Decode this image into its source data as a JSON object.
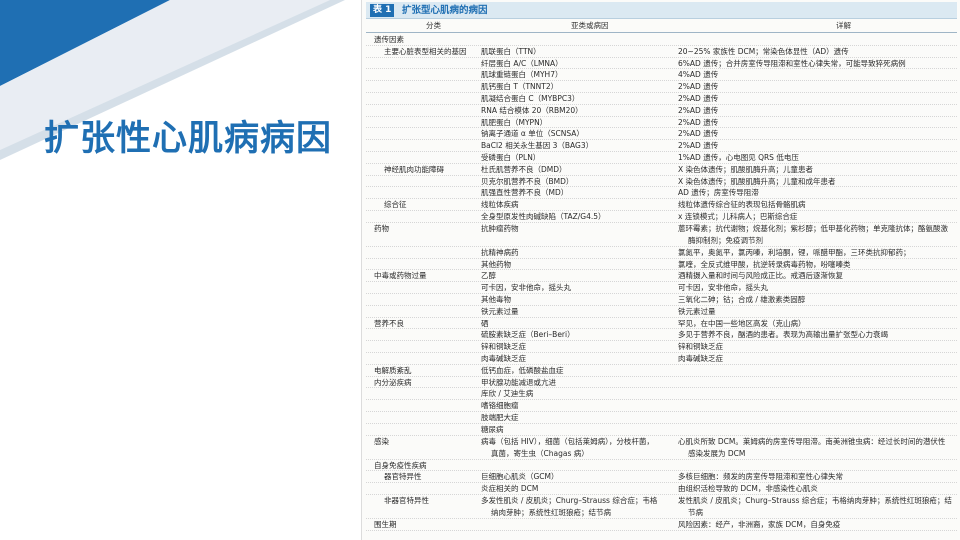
{
  "slide": {
    "title": "扩张性心肌病病因"
  },
  "table": {
    "tag": "表 1",
    "caption": "扩张型心肌病的病因",
    "headers": [
      "分类",
      "亚类或病因",
      "详解"
    ],
    "rows": [
      {
        "c1": "遗传因素",
        "c2": "",
        "c3": "",
        "lvl": 0
      },
      {
        "c1": "主要心脏表型相关的基因",
        "c2": "肌联蛋白（TTN）",
        "c3": "20~25% 家族性 DCM；常染色体显性（AD）遗传",
        "lvl": 1
      },
      {
        "c1": "",
        "c2": "纤层蛋白 A/C（LMNA）",
        "c3": "6%AD 遗传；合并房室传导阻滞和室性心律失常，可能导致猝死病例",
        "lvl": 1
      },
      {
        "c1": "",
        "c2": "肌球重链蛋白（MYH7）",
        "c3": "4%AD 遗传",
        "lvl": 1
      },
      {
        "c1": "",
        "c2": "肌钙蛋白 T（TNNT2）",
        "c3": "2%AD 遗传",
        "lvl": 1
      },
      {
        "c1": "",
        "c2": "肌凝结合蛋白 C（MYBPC3）",
        "c3": "2%AD 遗传",
        "lvl": 1
      },
      {
        "c1": "",
        "c2": "RNA 结合模体 20（RBM20）",
        "c3": "2%AD 遗传",
        "lvl": 1
      },
      {
        "c1": "",
        "c2": "肌肥蛋白（MYPN）",
        "c3": "2%AD 遗传",
        "lvl": 1
      },
      {
        "c1": "",
        "c2": "钠离子通道 α 单位（SCNSA）",
        "c3": "2%AD 遗传",
        "lvl": 1
      },
      {
        "c1": "",
        "c2": "BaCl2 相关永生基因 3（BAG3）",
        "c3": "2%AD 遗传",
        "lvl": 1
      },
      {
        "c1": "",
        "c2": "受磷蛋白（PLN）",
        "c3": "1%AD 遗传，心电图见 QRS 低电压",
        "lvl": 1
      },
      {
        "c1": "神经肌肉功能障碍",
        "c2": "杜氏肌营养不良（DMD）",
        "c3": "X 染色体遗传；肌酸肌酶升高；儿童患者",
        "lvl": 1
      },
      {
        "c1": "",
        "c2": "贝克尔肌营养不良（BMD）",
        "c3": "X 染色体遗传；肌酸肌酶升高；儿童和成年患者",
        "lvl": 1
      },
      {
        "c1": "",
        "c2": "肌强直性营养不良（MD）",
        "c3": "AD 遗传；房室传导阻滞",
        "lvl": 1
      },
      {
        "c1": "综合征",
        "c2": "线粒体疾病",
        "c3": "线粒体遗传综合征的表现包括骨骼肌病",
        "lvl": 1
      },
      {
        "c1": "",
        "c2": "全身型原发性肉碱缺陷（TAZ/G4.5）",
        "c3": "x 连锁模式；儿科病人；巴斯综合症",
        "lvl": 1
      },
      {
        "c1": "药物",
        "c2": "抗肿瘤药物",
        "c3": "蒽环霉素；抗代谢物；烷基化剂；紫杉醇；低甲基化药物；单克隆抗体；酪氨酸激",
        "c3b": "酶抑制剂；免疫调节剂",
        "lvl": 0
      },
      {
        "c1": "",
        "c2": "抗精神病药",
        "c3": "氯氮平，奥氮平，氯丙嗪，利培酮，锂，哌醋甲酯，三环类抗抑郁药；",
        "lvl": 0
      },
      {
        "c1": "",
        "c2": "其他药物",
        "c3": "氯喹，全反式维甲酸，抗逆转录病毒药物，吩噻嗪类",
        "lvl": 0
      },
      {
        "c1": "中毒或药物过量",
        "c2": "乙醇",
        "c3": "酒精摄入量和时间与风险成正比。戒酒后逐渐恢复",
        "lvl": 0
      },
      {
        "c1": "",
        "c2": "可卡因，安非他命，摇头丸",
        "c3": "可卡因，安非他命，摇头丸",
        "lvl": 0
      },
      {
        "c1": "",
        "c2": "其他毒物",
        "c3": "三氧化二砷；钴；合成 / 雄激素类固醇",
        "lvl": 0
      },
      {
        "c1": "",
        "c2": "铁元素过量",
        "c3": "铁元素过量",
        "lvl": 0
      },
      {
        "c1": "营养不良",
        "c2": "硒",
        "c3": "罕见，在中国一些地区高发（克山病）",
        "lvl": 0
      },
      {
        "c1": "",
        "c2": "硫胺素缺乏症（Beri–Beri）",
        "c3": "多见于营养不良，酗酒的患者。表现为高输出量扩张型心力衰竭",
        "lvl": 0
      },
      {
        "c1": "",
        "c2": "锌和铜缺乏症",
        "c3": "锌和铜缺乏症",
        "lvl": 0
      },
      {
        "c1": "",
        "c2": "肉毒碱缺乏症",
        "c3": "肉毒碱缺乏症",
        "lvl": 0
      },
      {
        "c1": "电解质紊乱",
        "c2": "低钙血症，低磷酸盐血症",
        "c3": "",
        "lvl": 0
      },
      {
        "c1": "内分泌疾病",
        "c2": "甲状腺功能减退或亢进",
        "c3": "",
        "lvl": 0
      },
      {
        "c1": "",
        "c2": "库欣 / 艾迪生病",
        "c3": "",
        "lvl": 0
      },
      {
        "c1": "",
        "c2": "嗜铬细胞瘤",
        "c3": "",
        "lvl": 0
      },
      {
        "c1": "",
        "c2": "肢端肥大症",
        "c3": "",
        "lvl": 0
      },
      {
        "c1": "",
        "c2": "糖尿病",
        "c3": "",
        "lvl": 0
      },
      {
        "c1": "感染",
        "c2": "病毒（包括 HIV），细菌（包括莱姆病），分枝杆菌，",
        "c2b": "真菌，寄生虫（Chagas 病）",
        "c3": "心肌炎所致 DCM。莱姆病的房室传导阻滞。南美洲锥虫病：经过长时间的潜伏性",
        "c3b": "感染发展为 DCM",
        "lvl": 0
      },
      {
        "c1": "自身免疫性疾病",
        "c2": "",
        "c3": "",
        "lvl": 0
      },
      {
        "c1": "器官特异性",
        "c2": "巨细胞心肌炎（GCM）",
        "c3": "多核巨细胞：频发的房室传导阻滞和室性心律失常",
        "lvl": 1
      },
      {
        "c1": "",
        "c2": "炎症相关的 DCM",
        "c3": "由组织活检导致的 DCM，非感染性心肌炎",
        "lvl": 1
      },
      {
        "c1": "非器官特异性",
        "c2": "多发性肌炎 / 皮肌炎；Churg–Strauss 综合症；韦格",
        "c2b": "纳肉芽肿；系统性红斑狼疮；结节病",
        "c3": "发性肌炎 / 皮肌炎；Churg–Strauss 综合症；韦格纳肉芽肿；系统性红斑狼疮；结",
        "c3b": "节病",
        "lvl": 1
      },
      {
        "c1": "围生期",
        "c2": "",
        "c3": "风险因素：经产，非洲裔，家族 DCM，自身免疫",
        "lvl": 0
      }
    ]
  }
}
